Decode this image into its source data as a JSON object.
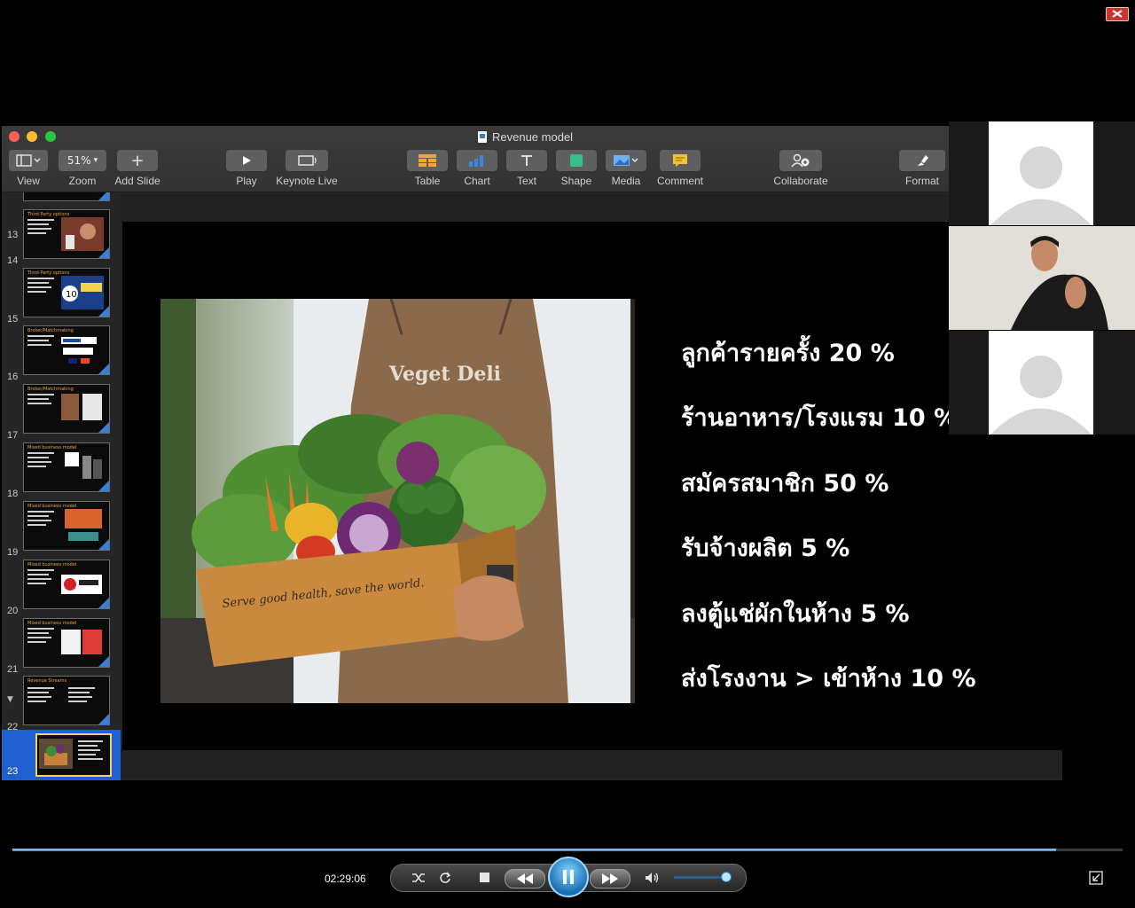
{
  "player": {
    "close_label": "",
    "time": "02:29:06",
    "progress_fraction": 0.94,
    "volume_fraction": 0.95
  },
  "keynote": {
    "window_title": "Revenue model",
    "toolbar": {
      "view": "View",
      "zoom_value": "51%",
      "zoom": "Zoom",
      "add_slide": "Add Slide",
      "play": "Play",
      "keynote_live": "Keynote Live",
      "table": "Table",
      "chart": "Chart",
      "text": "Text",
      "shape": "Shape",
      "media": "Media",
      "comment": "Comment",
      "collaborate": "Collaborate",
      "format": "Format"
    },
    "slides": [
      {
        "num": "13",
        "title": ""
      },
      {
        "num": "14",
        "title": "Third Party options"
      },
      {
        "num": "15",
        "title": "Third Party options"
      },
      {
        "num": "16",
        "title": "Broker/Matchmaking"
      },
      {
        "num": "17",
        "title": "Broker/Matchmaking"
      },
      {
        "num": "18",
        "title": "Mixed business model"
      },
      {
        "num": "19",
        "title": "Mixed business model"
      },
      {
        "num": "20",
        "title": "Mixed business model"
      },
      {
        "num": "21",
        "title": "Mixed business model"
      },
      {
        "num": "22",
        "title": "Revenue Streams"
      },
      {
        "num": "23",
        "title": ""
      }
    ],
    "current_slide": {
      "photo_caption": "Serve good health, save the world.",
      "apron_text": "Veget Deli",
      "bullets": [
        "ลูกค้ารายครั้ง  20 %",
        "ร้านอาหาร/โรงแรม  10 %",
        "สมัครสมาชิก 50 %",
        "รับจ้างผลิต 5 %",
        "ลงตู้แช่ผักในห้าง 5 %",
        "ส่งโรงงาน > เข้าห้าง 10 %"
      ]
    }
  },
  "colors": {
    "accent_blue": "#1f5fcf",
    "toolbar_orange": "#f0a63a",
    "seek_blue": "#3a89c9"
  }
}
